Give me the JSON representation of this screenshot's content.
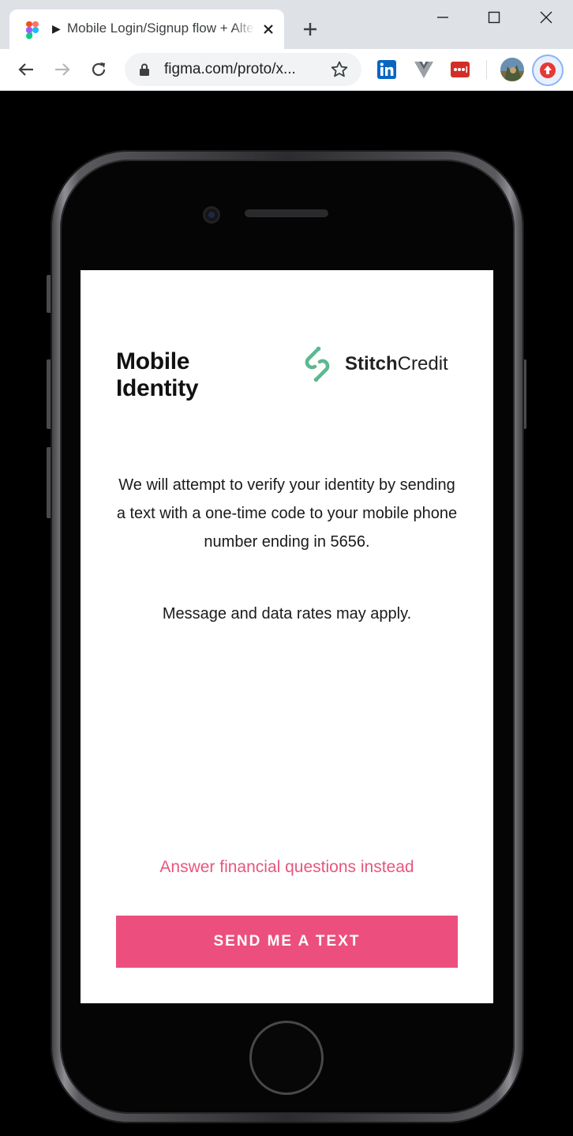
{
  "browser": {
    "tab": {
      "favicon": "figma-icon",
      "play_glyph": "▶",
      "title": "Mobile Login/Signup flow + Alternate"
    },
    "address_bar": {
      "url": "figma.com/proto/x..."
    },
    "extensions": [
      "linkedin-icon",
      "vue-devtools-icon",
      "lastpass-icon",
      "profile-avatar",
      "upload-extension-icon"
    ]
  },
  "screen": {
    "title_line1": "Mobile",
    "title_line2": "Identity",
    "brand": {
      "bold": "Stitch",
      "regular": "Credit",
      "color": "#5cb891"
    },
    "info_text": "We will attempt to verify your identity by sending a text with a one-time code to your mobile phone number ending in 5656.",
    "rates_text": "Message and data rates may apply.",
    "alt_link": "Answer financial questions instead",
    "send_button": "SEND ME A TEXT",
    "accent_color": "#ec4f7e"
  }
}
